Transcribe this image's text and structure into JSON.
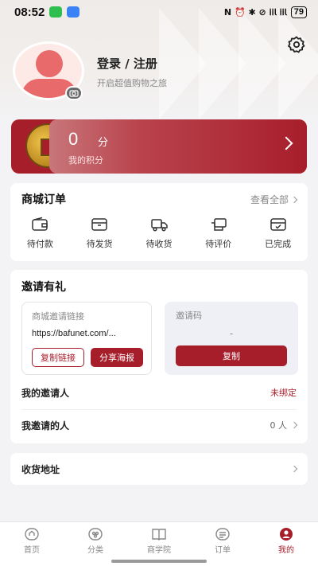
{
  "status_bar": {
    "time": "08:52",
    "indicators": "N ⏰ ✱ ⊘ 𝗂𝗂𝗅 𝗂𝗂𝗅",
    "battery": "79"
  },
  "header": {
    "login_label": "登录 / 注册",
    "subtitle": "开启超值购物之旅"
  },
  "points": {
    "value": "0",
    "unit": "分",
    "label": "我的积分"
  },
  "orders": {
    "title": "商城订单",
    "view_all": "查看全部",
    "items": [
      {
        "label": "待付款",
        "icon": "wallet-icon"
      },
      {
        "label": "待发货",
        "icon": "package-icon"
      },
      {
        "label": "待收货",
        "icon": "truck-icon"
      },
      {
        "label": "待评价",
        "icon": "review-icon"
      },
      {
        "label": "已完成",
        "icon": "completed-box-icon"
      }
    ]
  },
  "invite": {
    "title": "邀请有礼",
    "link_title": "商城邀请链接",
    "link_url": "https://bafunet.com/...",
    "copy_link": "复制链接",
    "share_poster": "分享海报",
    "code_title": "邀请码",
    "code_value": "-",
    "copy_code": "复制",
    "my_inviter_label": "我的邀请人",
    "my_inviter_value": "未绑定",
    "invited_label": "我邀请的人",
    "invited_value": "0 人"
  },
  "address": {
    "label": "收货地址"
  },
  "tabbar": {
    "items": [
      {
        "label": "首页",
        "icon": "home-icon",
        "active": false
      },
      {
        "label": "分类",
        "icon": "category-icon",
        "active": false
      },
      {
        "label": "商学院",
        "icon": "book-icon",
        "active": false
      },
      {
        "label": "订单",
        "icon": "order-list-icon",
        "active": false
      },
      {
        "label": "我的",
        "icon": "profile-icon",
        "active": true
      }
    ]
  },
  "colors": {
    "accent": "#a71e2b",
    "inviter_status": "#a71e2b"
  }
}
